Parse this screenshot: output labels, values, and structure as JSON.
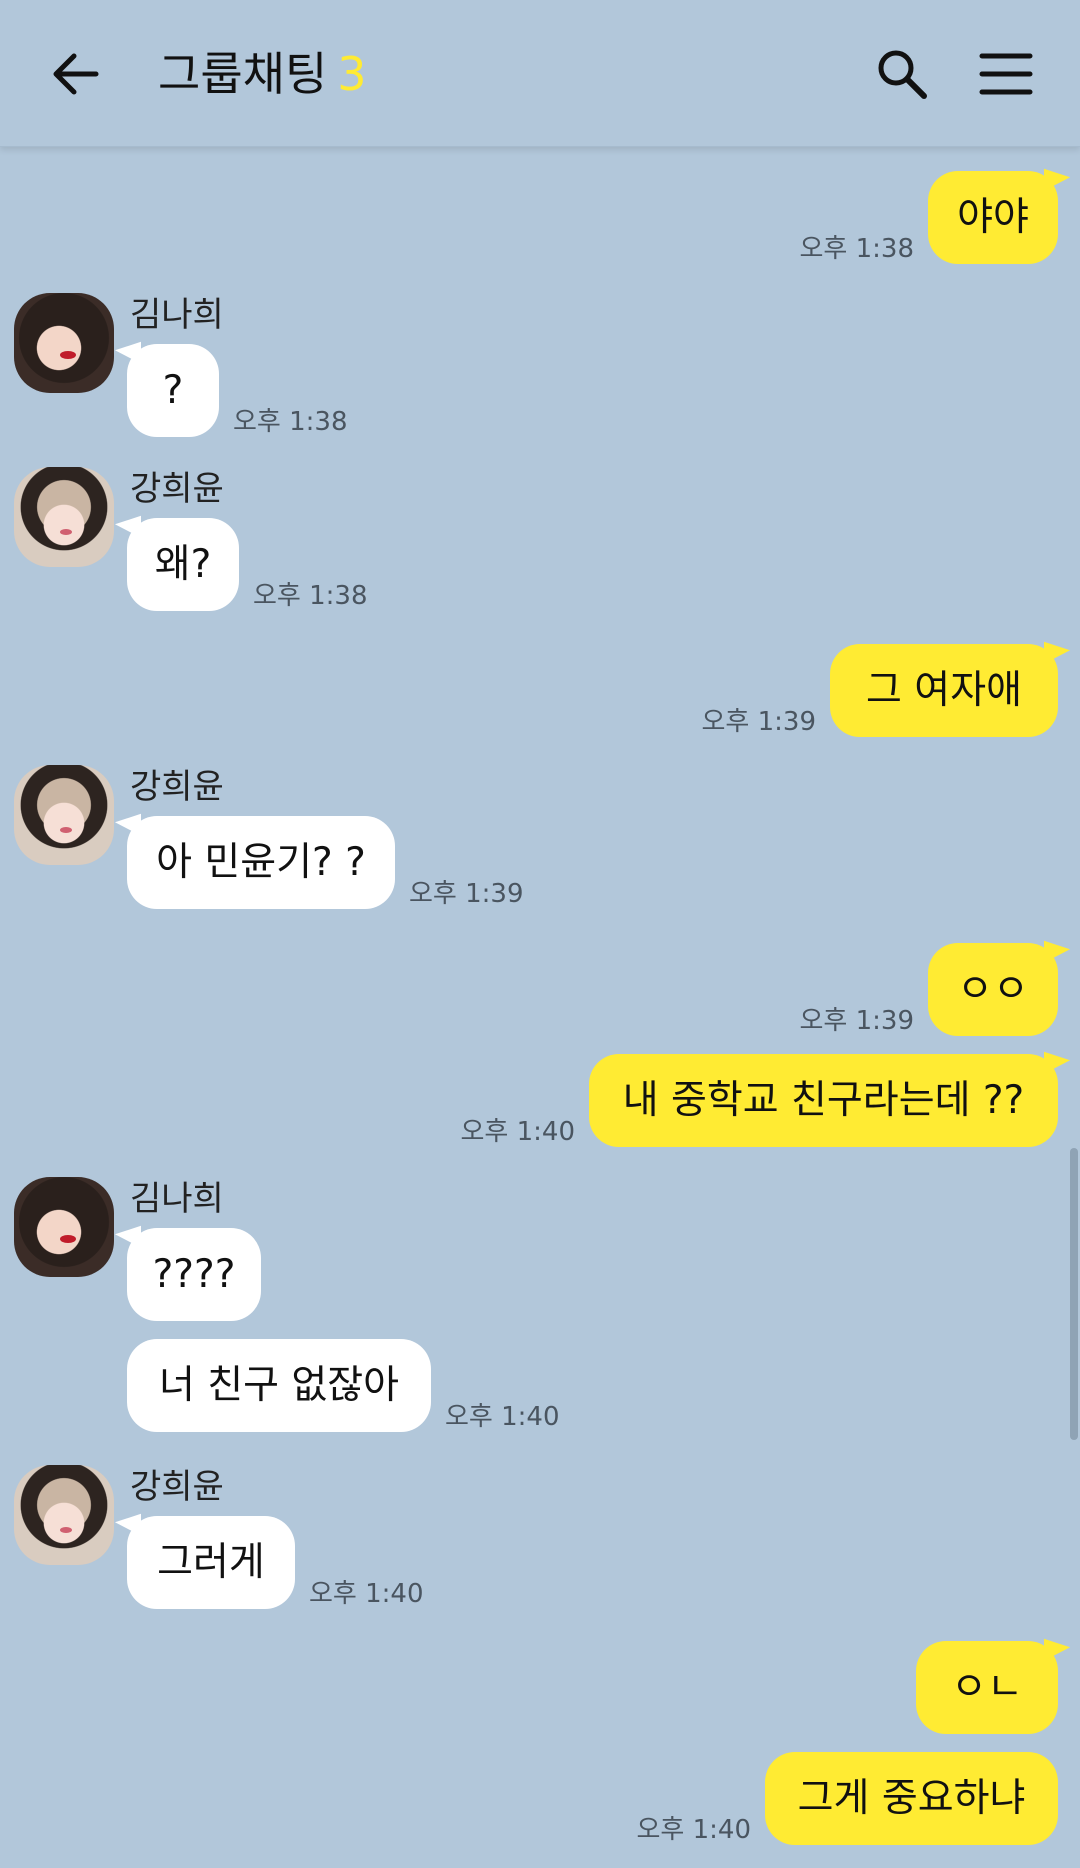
{
  "header": {
    "title": "그룹채팅",
    "member_count": "3",
    "back_icon": "arrow-left-icon",
    "search_icon": "search-icon",
    "menu_icon": "hamburger-menu-icon"
  },
  "colors": {
    "background": "#b2c7da",
    "my_bubble": "#ffeb33",
    "other_bubble": "#ffffff",
    "member_count": "#ffeb33"
  },
  "messages": [
    {
      "type": "mine",
      "text": "야야",
      "time": "오후 1:38"
    },
    {
      "sender": "김나희",
      "text": "?",
      "time": "오후 1:38"
    },
    {
      "sender": "강희윤",
      "text": "왜?",
      "time": "오후 1:38"
    },
    {
      "type": "mine",
      "text": "그 여자애",
      "time": "오후 1:39"
    },
    {
      "sender": "강희윤",
      "text": "아 민윤기? ?",
      "time": "오후 1:39"
    },
    {
      "type": "mine",
      "text": "ㅇㅇ",
      "time": "오후 1:39"
    },
    {
      "type": "mine",
      "text": "내 중학교 친구라는데 ??",
      "time": "오후 1:40"
    },
    {
      "sender": "김나희",
      "text": "????",
      "time": ""
    },
    {
      "sender": "김나희",
      "text": "너 친구 없잖아",
      "time": "오후 1:40"
    },
    {
      "sender": "강희윤",
      "text": "그러게",
      "time": "오후 1:40"
    },
    {
      "type": "mine",
      "text": "ㅇㄴ",
      "time": ""
    },
    {
      "type": "mine",
      "text": "그게 중요하냐",
      "time": "오후 1:40"
    }
  ]
}
